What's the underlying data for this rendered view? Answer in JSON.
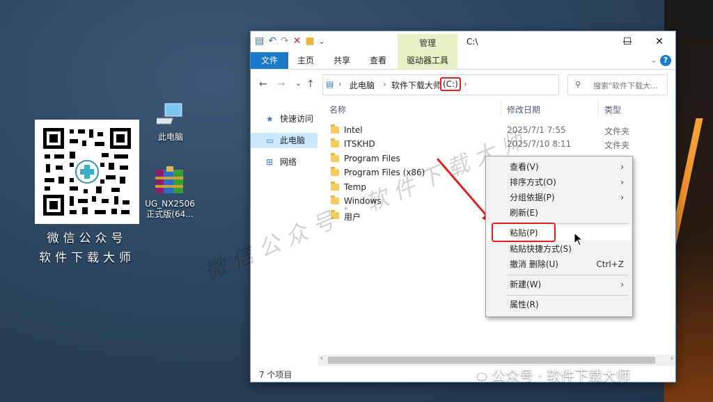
{
  "desktop": {
    "icons": [
      {
        "label": "此电脑",
        "icon": "computer-icon"
      },
      {
        "label_line1": "UG_NX2506",
        "label_line2": "正式版(64...",
        "icon": "winrar-archive-icon"
      }
    ],
    "qr_caption_line1": "微信公众号",
    "qr_caption_line2": "软件下载大师"
  },
  "window": {
    "title": "C:\\",
    "manage_tab": "管理",
    "controls": {
      "minimize": "—",
      "maximize": "☐",
      "close": "✕"
    },
    "ribbon_tabs": [
      "文件",
      "主页",
      "共享",
      "查看",
      "驱动器工具"
    ],
    "help": "?",
    "address": {
      "crumbs": [
        "此电脑",
        "软件下载大师",
        "(C:)"
      ],
      "separator": "›",
      "dropdown": "⌄",
      "refresh": "↻"
    },
    "search": {
      "placeholder": "搜索\"软件下载大..."
    },
    "nav_buttons": {
      "back": "←",
      "forward": "→",
      "recent": "⌄",
      "up": "↑"
    },
    "nav_pane": [
      {
        "label": "快速访问",
        "icon": "star-icon",
        "selected": false
      },
      {
        "label": "此电脑",
        "icon": "monitor-icon",
        "selected": true
      },
      {
        "label": "网络",
        "icon": "network-icon",
        "selected": false
      }
    ],
    "columns": [
      "名称",
      "修改日期",
      "类型"
    ],
    "files": [
      {
        "name": "Intel",
        "date": "2025/7/1 7:55",
        "type": "文件夹"
      },
      {
        "name": "ITSKHD",
        "date": "2025/7/10 8:11",
        "type": "文件夹"
      },
      {
        "name": "Program Files",
        "date": "",
        "type": ""
      },
      {
        "name": "Program Files (x86)",
        "date": "",
        "type": ""
      },
      {
        "name": "Temp",
        "date": "",
        "type": ""
      },
      {
        "name": "Windows",
        "date": "",
        "type": ""
      },
      {
        "name": "用户",
        "date": "",
        "type": ""
      }
    ],
    "status": "7 个项目"
  },
  "context_menu": {
    "items": [
      {
        "label": "查看(V)",
        "submenu": true
      },
      {
        "label": "排序方式(O)",
        "submenu": true
      },
      {
        "label": "分组依据(P)",
        "submenu": true
      },
      {
        "label": "刷新(E)",
        "submenu": false
      },
      {
        "label": "粘贴(P)",
        "submenu": false,
        "highlighted": true
      },
      {
        "label": "粘贴快捷方式(S)",
        "submenu": false
      },
      {
        "label": "撤消 删除(U)",
        "shortcut": "Ctrl+Z"
      },
      {
        "label": "新建(W)",
        "submenu": true
      },
      {
        "label": "属性(R)",
        "submenu": false
      }
    ],
    "submenu_glyph": "›"
  },
  "watermark": "微信公众号：软件下载大师",
  "footer_watermark": "公众号 · 软件下载大师",
  "colors": {
    "accent": "#1979ca",
    "highlight_red": "#e02020",
    "manage_tab_bg": "#e6f3c7",
    "selected_nav": "#cce8ff"
  }
}
